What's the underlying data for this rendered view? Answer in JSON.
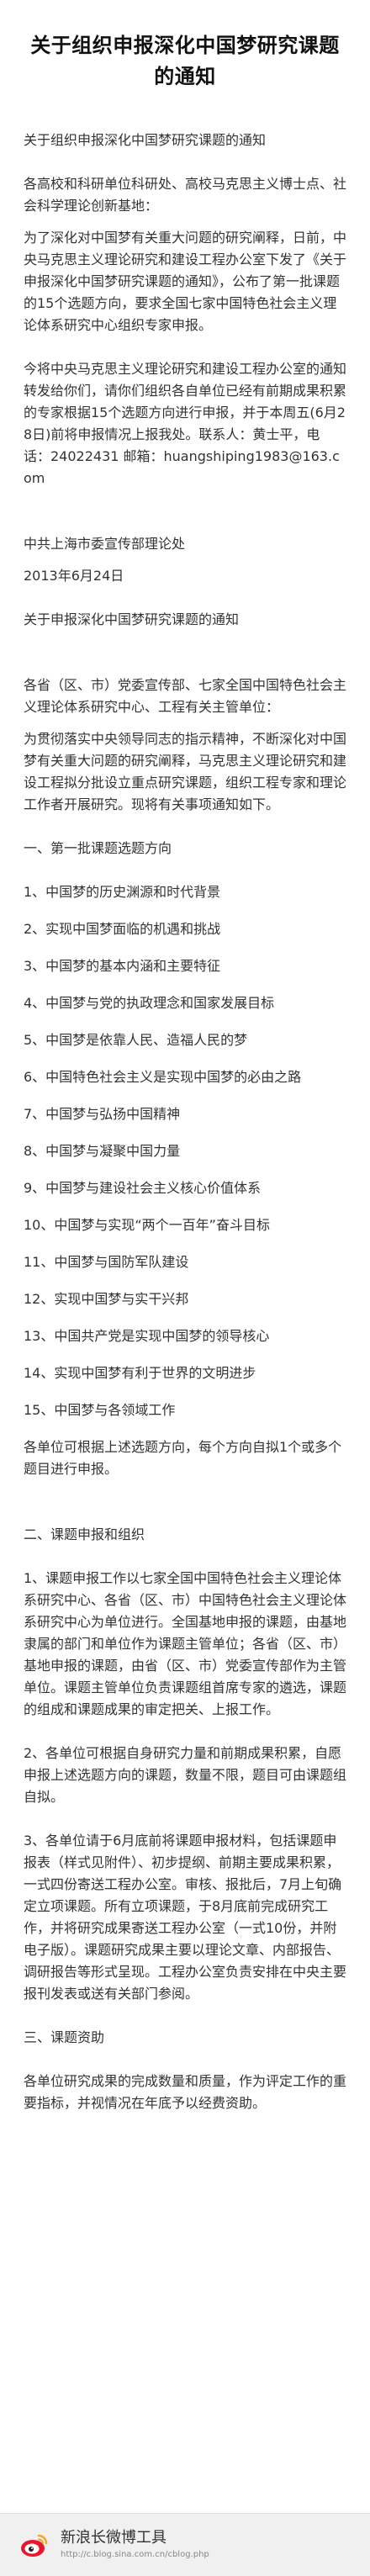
{
  "title": "关于组织申报深化中国梦研究课题的通知",
  "paragraphs": [
    "关于组织申报深化中国梦研究课题的通知",
    "各高校和科研单位科研处、高校马克思主义博士点、社会科学理论创新基地：",
    "为了深化对中国梦有关重大问题的研究阐释，日前，中央马克思主义理论研究和建设工程办公室下发了《关于申报深化中国梦研究课题的通知》，公布了第一批课题的15个选题方向，要求全国七家中国特色社会主义理论体系研究中心组织专家申报。",
    "今将中央马克思主义理论研究和建设工程办公室的通知转发给你们，请你们组织各自单位已经有前期成果积累的专家根据15个选题方向进行申报，并于本周五(6月28日)前将申报情况上报我处。联系人：黄士平，电话：24022431 邮箱：huangshiping1983@163.com",
    "",
    "中共上海市委宣传部理论处",
    "2013年6月24日",
    "关于申报深化中国梦研究课题的通知",
    "",
    "各省（区、市）党委宣传部、七家全国中国特色社会主义理论体系研究中心、工程有关主管单位：",
    "为贯彻落实中央领导同志的指示精神，不断深化对中国梦有关重大问题的研究阐释，马克思主义理论研究和建设工程拟分批设立重点研究课题，组织工程专家和理论工作者开展研究。现将有关事项通知如下。",
    "一、第一批课题选题方向"
  ],
  "topics": [
    "1、中国梦的历史渊源和时代背景",
    "2、实现中国梦面临的机遇和挑战",
    "3、中国梦的基本内涵和主要特征",
    "4、中国梦与党的执政理念和国家发展目标",
    "5、中国梦是依靠人民、造福人民的梦",
    "6、中国特色社会主义是实现中国梦的必由之路",
    "7、中国梦与弘扬中国精神",
    "8、中国梦与凝聚中国力量",
    "9、中国梦与建设社会主义核心价值体系",
    "10、中国梦与实现“两个一百年”奋斗目标",
    "11、中国梦与国防军队建设",
    "12、实现中国梦与实干兴邦",
    "13、中国共产党是实现中国梦的领导核心",
    "14、实现中国梦有利于世界的文明进步",
    "15、中国梦与各领域工作"
  ],
  "paragraphs2": [
    "各单位可根据上述选题方向，每个方向自拟1个或多个题目进行申报。",
    "",
    "二、课题申报和组织",
    "1、课题申报工作以七家全国中国特色社会主义理论体系研究中心、各省（区、市）中国特色社会主义理论体系研究中心为单位进行。全国基地申报的课题，由基地隶属的部门和单位作为课题主管单位；各省（区、市）基地申报的课题，由省（区、市）党委宣传部作为主管单位。课题主管单位负责课题组首席专家的遴选，课题的组成和课题成果的审定把关、上报工作。",
    "2、各单位可根据自身研究力量和前期成果积累，自愿申报上述选题方向的课题，数量不限，题目可由课题组自拟。",
    "3、各单位请于6月底前将课题申报材料，包括课题申报表（样式见附件）、初步提纲、前期主要成果积累，一式四份寄送工程办公室。审核、报批后，7月上旬确定立项课题。所有立项课题，于8月底前完成研究工作，并将研究成果寄送工程办公室（一式10份，并附电子版）。课题研究成果主要以理论文章、内部报告、调研报告等形式呈现。工程办公室负责安排在中央主要报刊发表或送有关部门参阅。",
    "三、课题资助",
    "各单位研究成果的完成数量和质量，作为评定工作的重要指标，并视情况在年底予以经费资助。"
  ],
  "footer": {
    "name": "新浪长微博工具",
    "url": "http://c.blog.sina.com.cn/cblog.php"
  },
  "colors": {
    "logo_red": "#e6162d",
    "logo_yellow": "#f6a623"
  }
}
